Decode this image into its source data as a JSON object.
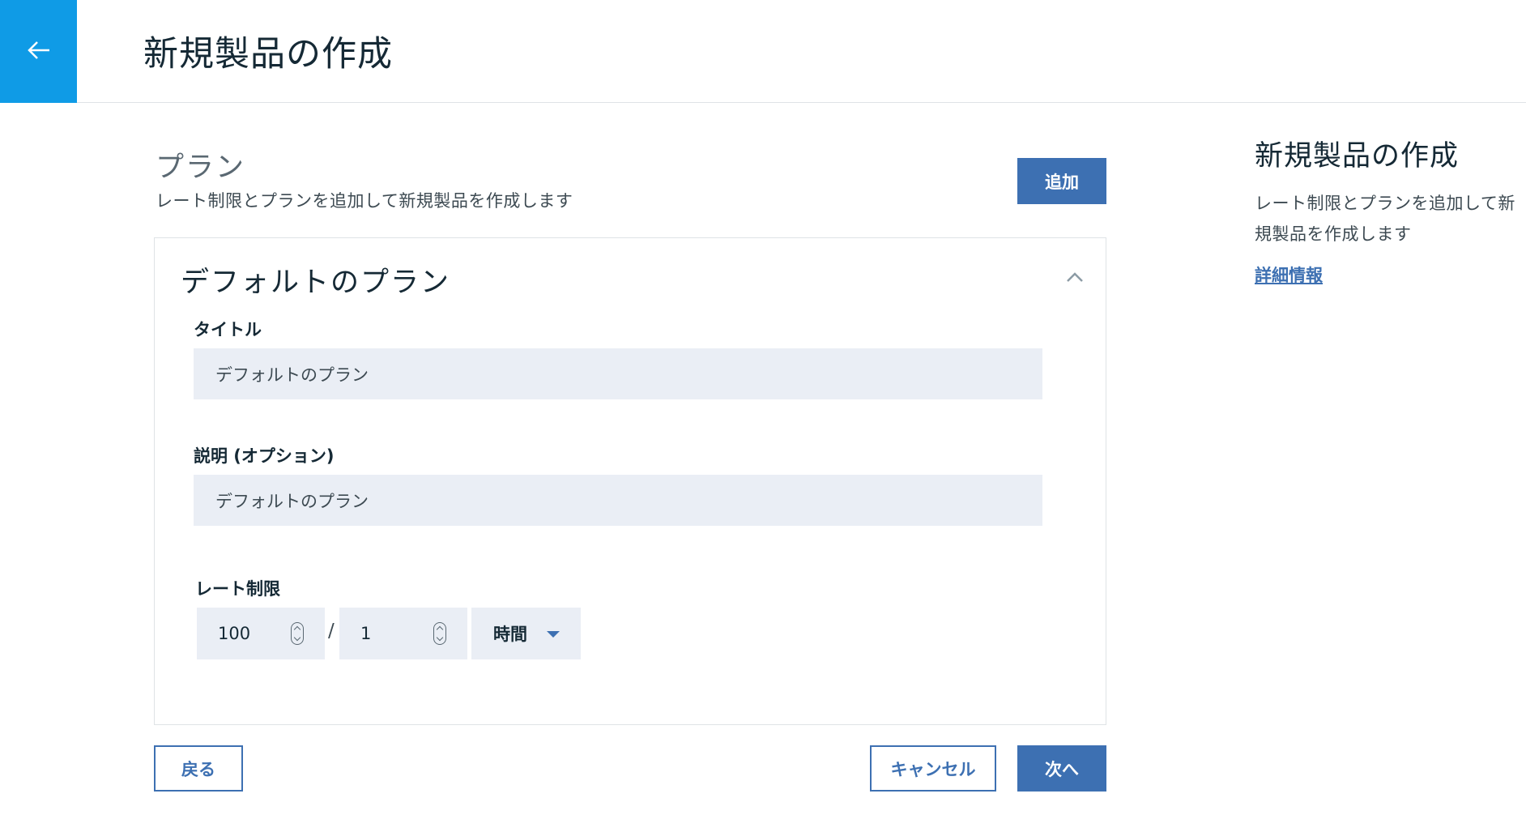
{
  "header": {
    "title": "新規製品の作成",
    "back_icon": "arrow-left-icon"
  },
  "section": {
    "title": "プラン",
    "subtitle": "レート制限とプランを追加して新規製品を作成します",
    "add_label": "追加"
  },
  "plan": {
    "title": "デフォルトのプラン",
    "collapse_icon": "chevron-up-icon",
    "title_field": {
      "label": "タイトル",
      "value": "デフォルトのプラン"
    },
    "description_field": {
      "label": "説明 (オプション)",
      "value": "デフォルトのプラン"
    },
    "rate_limit": {
      "label": "レート制限",
      "calls": "100",
      "separator": "/",
      "period_count": "1",
      "period_unit": "時間"
    }
  },
  "footer": {
    "back_label": "戻る",
    "cancel_label": "キャンセル",
    "next_label": "次へ"
  },
  "side_panel": {
    "title": "新規製品の作成",
    "description": "レート制限とプランを追加して新規製品を作成します",
    "link_label": "詳細情報"
  },
  "colors": {
    "back_button": "#0f9be6",
    "primary": "#3d70b2",
    "input_bg": "#eaeef5"
  }
}
